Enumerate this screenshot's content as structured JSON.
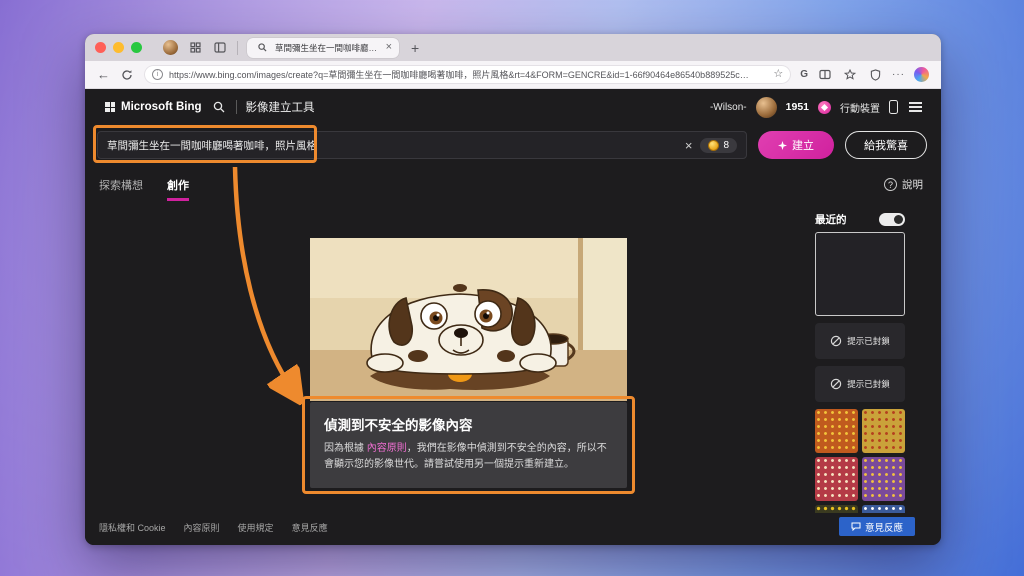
{
  "colors": {
    "accent": "#d0219e",
    "annotation": "#ee8a2e",
    "feedback": "#2c63c9",
    "link": "#f06fd2"
  },
  "icons": {
    "close": "×",
    "new_tab": "+",
    "back": "←",
    "star_outline": "☆",
    "more": "···",
    "translate": "G",
    "help": "?",
    "site_info": "i"
  },
  "browser": {
    "tab_title": "草間彌生坐在一間咖啡廳喝著咖...",
    "url": "https://www.bing.com/images/create?q=草間彌生坐在一間咖啡廳喝著咖啡，照片風格&rt=4&FORM=GENCRE&id=1-66f90464e86540b889525c…"
  },
  "header": {
    "brand": "Microsoft Bing",
    "app_title": "影像建立工具",
    "user_name": "-Wilson-",
    "points": "1951",
    "mobile_label": "行動裝置"
  },
  "prompt_bar": {
    "value": "草間彌生坐在一間咖啡廳喝著咖啡，照片風格",
    "coins": "8",
    "create_label": "建立",
    "surprise_label": "給我驚喜"
  },
  "tabs": [
    {
      "label": "探索構想"
    },
    {
      "label": "創作"
    }
  ],
  "help_label": "說明",
  "warning": {
    "title": "偵測到不安全的影像內容",
    "body_prefix": "因為根據 ",
    "link": "內容原則",
    "body_suffix": "，我們在影像中偵測到不安全的內容，所以不會顯示您的影像世代。請嘗試使用另一個提示重新建立。"
  },
  "sidebar": {
    "recent_label": "最近的",
    "blocked_label": "提示已封鎖"
  },
  "footer": {
    "links": [
      "隱私權和 Cookie",
      "內容原則",
      "使用規定",
      "意見反應"
    ],
    "feedback_label": "意見反應"
  }
}
